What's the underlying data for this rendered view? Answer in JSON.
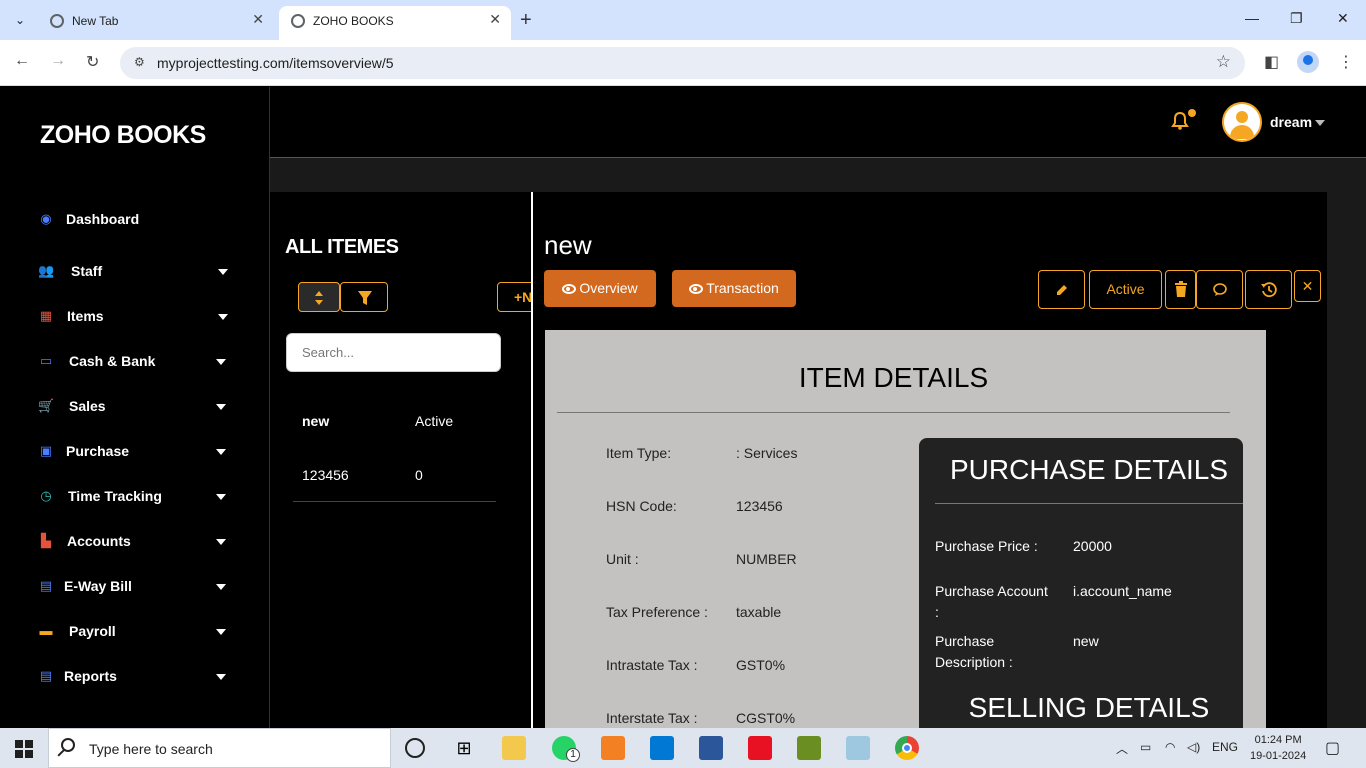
{
  "browser": {
    "tabs": [
      {
        "title": "New Tab"
      },
      {
        "title": "ZOHO BOOKS"
      }
    ],
    "url": "myprojecttesting.com/itemsoverview/5"
  },
  "app": {
    "brand": "ZOHO BOOKS",
    "accent_color": "#f5a623",
    "primary_button_color": "#d2691e",
    "user": {
      "name": "dream"
    }
  },
  "sidebar": {
    "items": [
      {
        "label": "Dashboard",
        "icon": "dashboard-icon",
        "color": "#4a7dff"
      },
      {
        "label": "Staff",
        "icon": "users-icon",
        "color": "#2ec4b6"
      },
      {
        "label": "Items",
        "icon": "grid-icon",
        "color": "#e5533d"
      },
      {
        "label": "Cash & Bank",
        "icon": "money-icon",
        "color": "#4a7dff"
      },
      {
        "label": "Sales",
        "icon": "cart-icon",
        "color": "#f5a623"
      },
      {
        "label": "Purchase",
        "icon": "bag-icon",
        "color": "#4a7dff"
      },
      {
        "label": "Time Tracking",
        "icon": "clock-icon",
        "color": "#2ec4b6"
      },
      {
        "label": "Accounts",
        "icon": "chart-icon",
        "color": "#e5533d"
      },
      {
        "label": "E-Way Bill",
        "icon": "file-icon",
        "color": "#4a7dff"
      },
      {
        "label": "Payroll",
        "icon": "card-icon",
        "color": "#f5a623"
      },
      {
        "label": "Reports",
        "icon": "report-icon",
        "color": "#4a7dff"
      }
    ]
  },
  "list": {
    "title": "ALL ITEMES",
    "add_label": "+N",
    "search_placeholder": "Search...",
    "columns": [
      "new",
      "Active"
    ],
    "rows": [
      {
        "name": "123456",
        "status": "0"
      }
    ]
  },
  "detail": {
    "title": "new",
    "overview_label": "Overview",
    "transaction_label": "Transaction",
    "status_label": "Active",
    "card_heading": "ITEM DETAILS",
    "fields": [
      {
        "label": "Item Type:",
        "value": ": Services"
      },
      {
        "label": "HSN Code:",
        "value": "123456"
      },
      {
        "label": "Unit :",
        "value": "NUMBER"
      },
      {
        "label": "Tax Preference :",
        "value": "taxable"
      },
      {
        "label": "Intrastate Tax :",
        "value": "GST0%"
      },
      {
        "label": "Interstate Tax :",
        "value": "CGST0%"
      }
    ],
    "purchase": {
      "heading": "PURCHASE DETAILS",
      "fields": [
        {
          "label": "Purchase Price :",
          "value": "20000"
        },
        {
          "label": "Purchase Account :",
          "value": "i.account_name"
        },
        {
          "label": "Purchase Description :",
          "value": "new"
        }
      ],
      "next_heading": "SELLING DETAILS"
    }
  },
  "taskbar": {
    "search_placeholder": "Type here to search",
    "language": "ENG",
    "time": "01:24 PM",
    "date": "19-01-2024",
    "whatsapp_badge": "1"
  }
}
